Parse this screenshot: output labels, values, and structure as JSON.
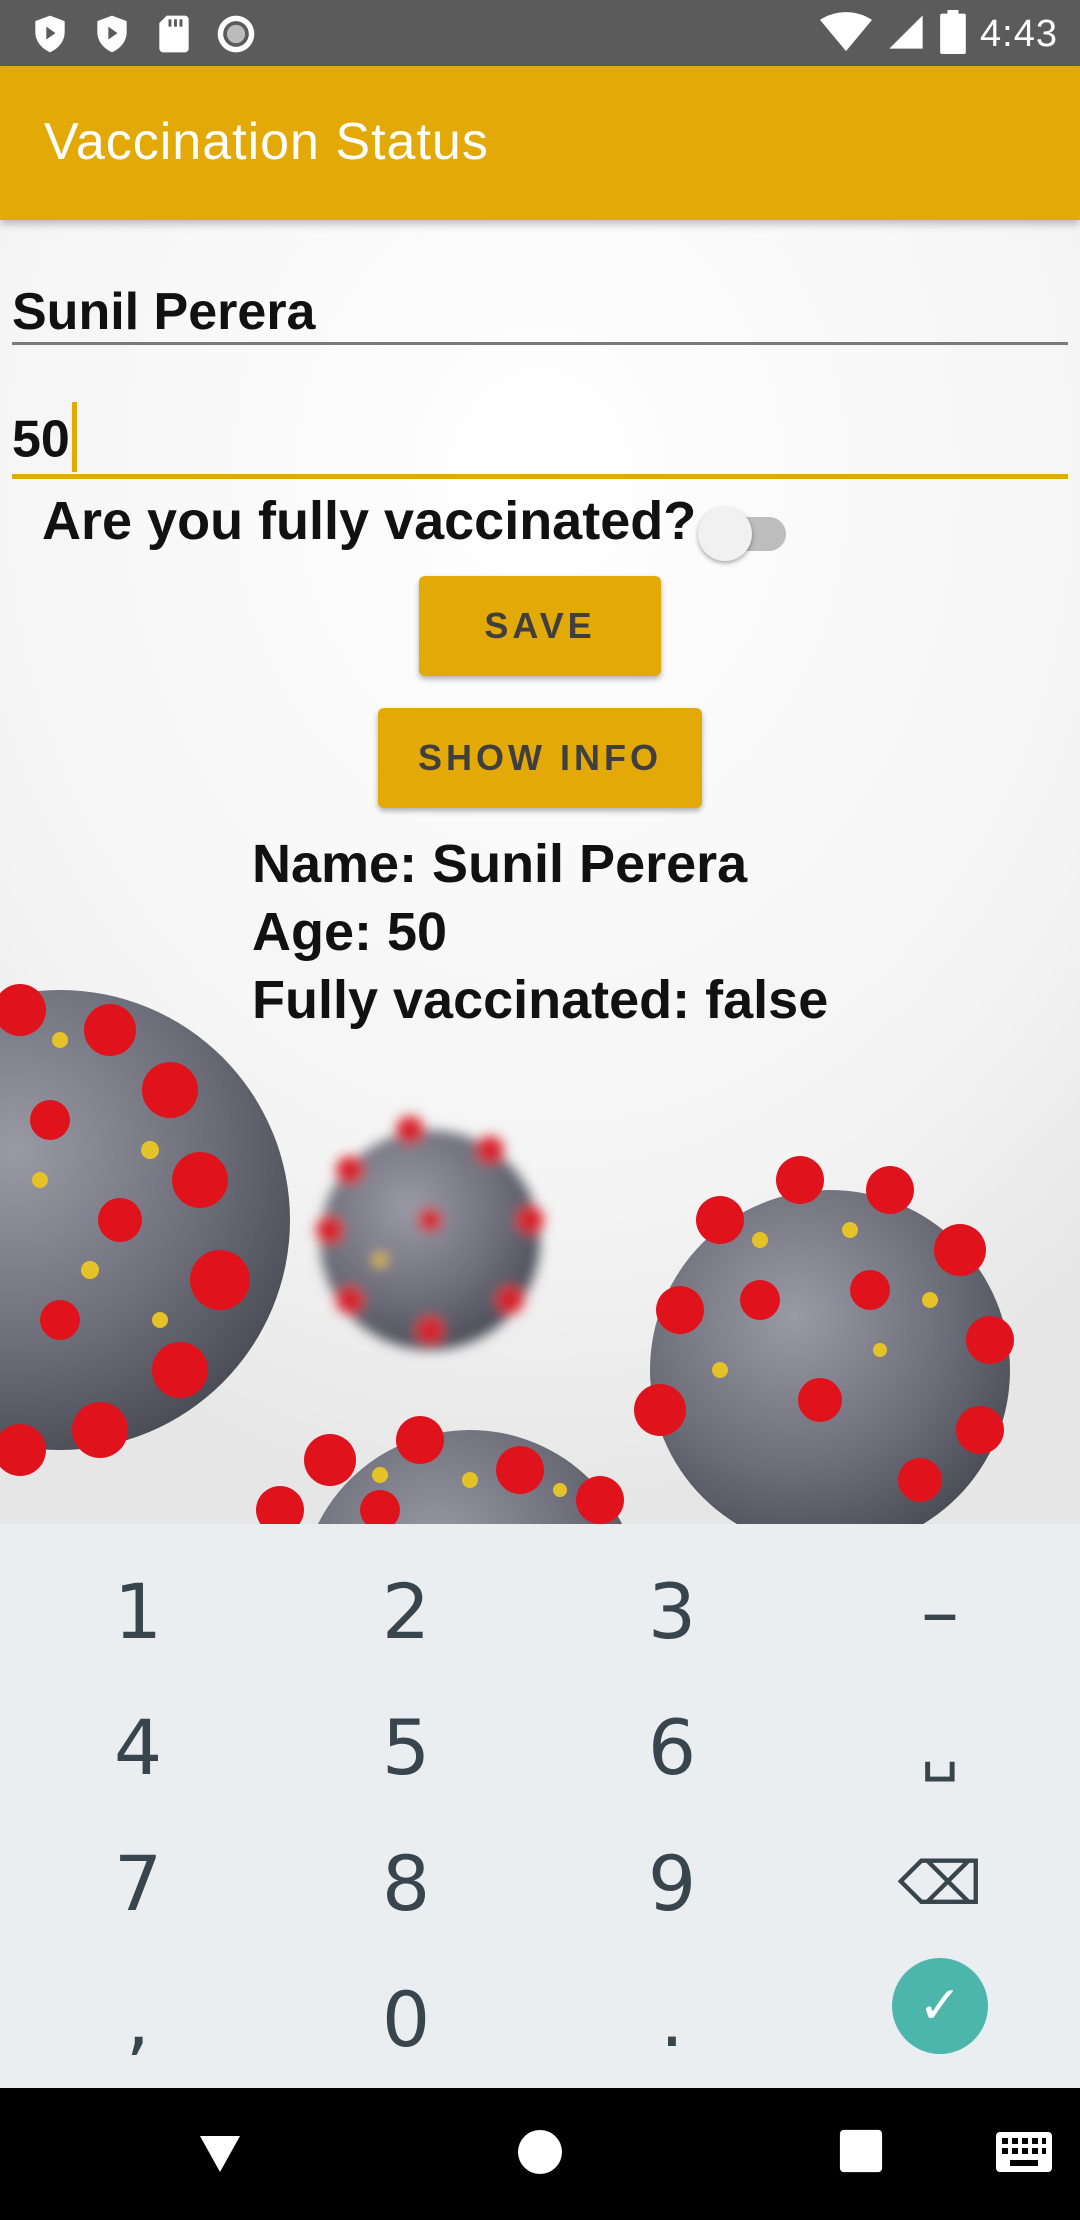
{
  "status_bar": {
    "time": "4:43",
    "left_icons": [
      "shield-icon",
      "play-protect-icon",
      "sd-card-icon",
      "record-icon"
    ],
    "right_icons": [
      "wifi-icon",
      "signal-icon",
      "battery-icon"
    ]
  },
  "app_bar": {
    "title": "Vaccination Status"
  },
  "form": {
    "name_value": "Sunil Perera",
    "age_value": "50",
    "question": "Are you fully vaccinated?",
    "vaccinated_toggle_on": false,
    "save_label": "SAVE",
    "show_info_label": "SHOW INFO"
  },
  "info": {
    "name_line": "Name: Sunil Perera",
    "age_line": "Age: 50",
    "vaccinated_line": "Fully vaccinated: false"
  },
  "keyboard": {
    "keys": [
      "1",
      "2",
      "3",
      "–",
      "4",
      "5",
      "6",
      "␣",
      "7",
      "8",
      "9",
      "⌫",
      ",",
      "0",
      ".",
      "✓"
    ]
  },
  "colors": {
    "accent": "#E3A906",
    "status_bar": "#5B5B5B",
    "keyboard_bg": "#EBEEF1",
    "done_key": "#4DB6AC"
  },
  "nav_bar": {
    "icons": [
      "back-icon",
      "home-icon",
      "recents-icon",
      "keyboard-icon"
    ]
  }
}
